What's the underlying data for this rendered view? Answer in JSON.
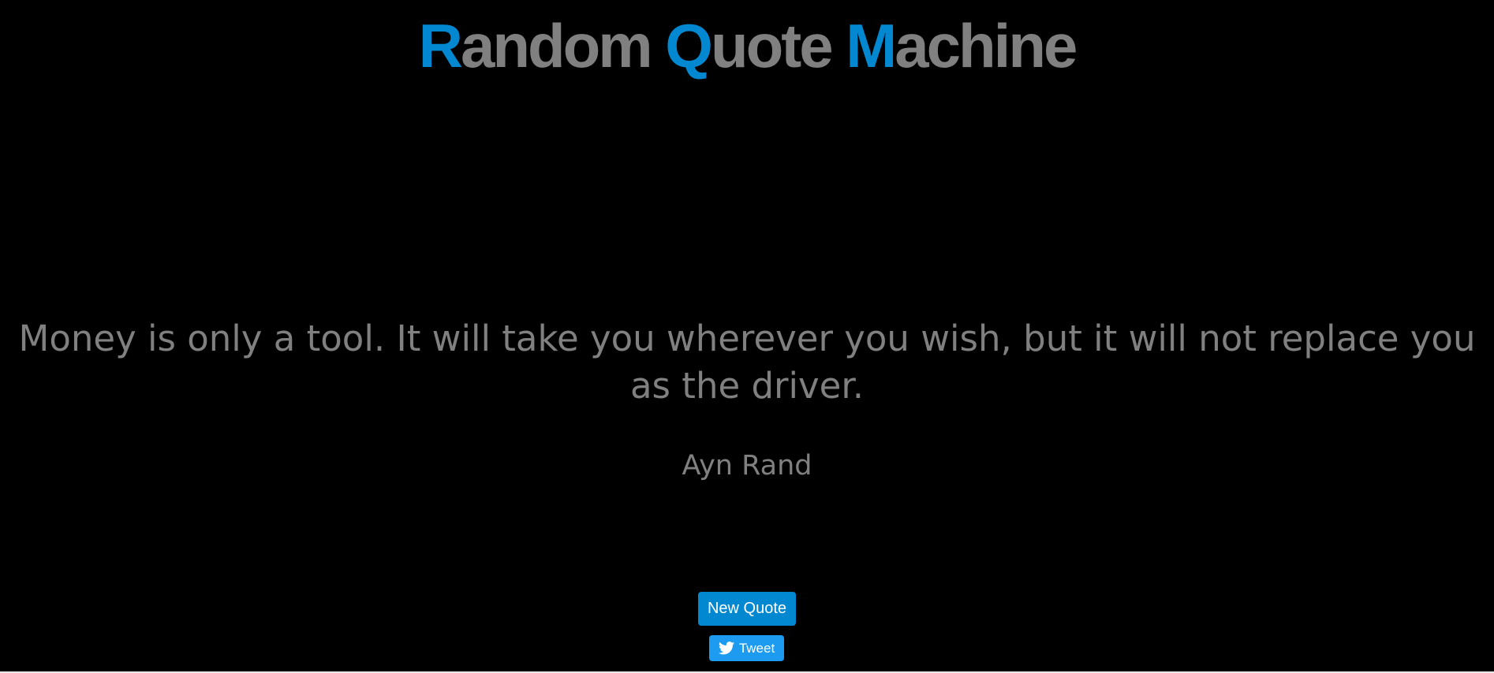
{
  "header": {
    "title_parts": [
      {
        "accent": "R",
        "rest": "andom "
      },
      {
        "accent": "Q",
        "rest": "uote "
      },
      {
        "accent": "M",
        "rest": "achine"
      }
    ]
  },
  "quote": {
    "text": "Money is only a tool. It will take you wherever you wish, but it will not replace you as the driver.",
    "author": "Ayn Rand"
  },
  "actions": {
    "new_quote_label": "New Quote",
    "tweet_label": "Tweet",
    "tweet_icon": "twitter-bird-icon"
  },
  "colors": {
    "background": "#000000",
    "accent": "#0288d1",
    "text": "#808080",
    "tweet_button": "#1d9bf0"
  }
}
